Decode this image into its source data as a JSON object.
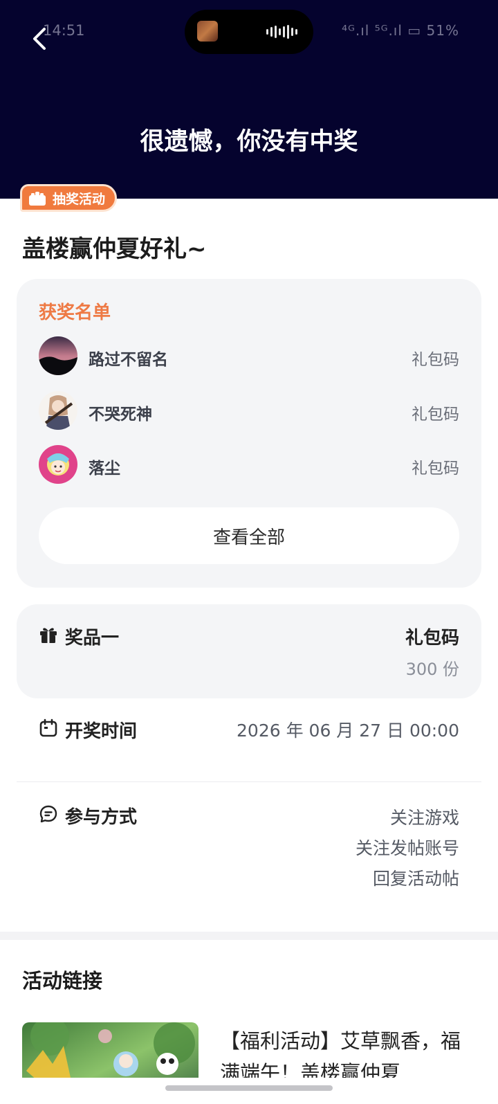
{
  "status_bar": {
    "time": "14:51",
    "right_text": "⁴ᴳ.ıl ⁵ᴳ.ıl ▭ 51%"
  },
  "header": {
    "title": "很遗憾，你没有中奖"
  },
  "post": {
    "tag_label": "抽奖活动",
    "title": "盖楼赢仲夏好礼~"
  },
  "winners": {
    "heading": "获奖名单",
    "items": [
      {
        "name": "路过不留名",
        "prize": "礼包码"
      },
      {
        "name": "不哭死神",
        "prize": "礼包码"
      },
      {
        "name": "落尘",
        "prize": "礼包码"
      }
    ],
    "view_all_label": "查看全部"
  },
  "prize": {
    "label": "奖品一",
    "name": "礼包码",
    "count": "300 份"
  },
  "draw_time": {
    "label": "开奖时间",
    "value": "2026 年 06 月 27 日 00:00"
  },
  "join": {
    "label": "参与方式",
    "methods": [
      "关注游戏",
      "关注发帖账号",
      "回复活动帖"
    ]
  },
  "links": {
    "heading": "活动链接",
    "items": [
      {
        "text": "【福利活动】艾草飘香，福满端午！盖楼赢仲夏"
      }
    ]
  },
  "colors": {
    "header_bg": "#05032e",
    "accent_orange": "#f07a3e",
    "card_bg": "#f4f5f7"
  }
}
